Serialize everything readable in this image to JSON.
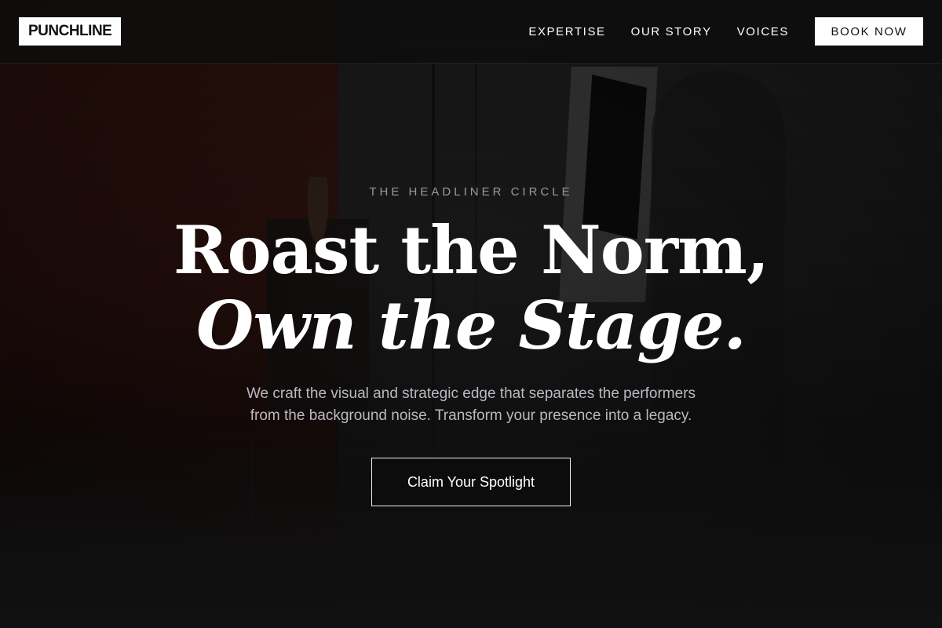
{
  "header": {
    "logo": "PUNCHLINE",
    "nav": [
      {
        "label": "EXPERTISE"
      },
      {
        "label": "OUR STORY"
      },
      {
        "label": "VOICES"
      }
    ],
    "book_button": "BOOK NOW"
  },
  "hero": {
    "eyebrow": "THE HEADLINER CIRCLE",
    "title_line1": "Roast the Norm,",
    "title_line2": "Own the Stage.",
    "subtitle_line1": "We craft the visual and strategic edge that separates the performers",
    "subtitle_line2": "from the background noise. Transform your presence into a legacy.",
    "cta": "Claim Your Spotlight"
  },
  "colors": {
    "background": "#111111",
    "accent_wall": "#3c1711",
    "text_primary": "#ffffff",
    "text_muted": "#9a9a9a",
    "subtitle": "#b9b9c2"
  }
}
